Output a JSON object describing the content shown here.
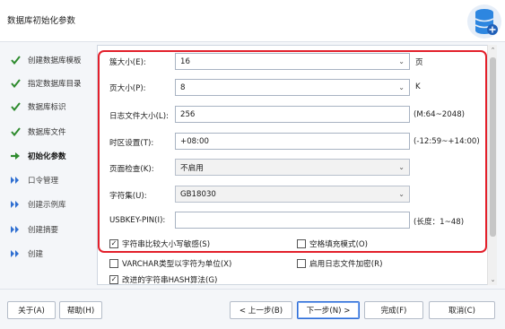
{
  "window": {
    "title": "数据库初始化参数"
  },
  "sidebar": {
    "items": [
      {
        "label": "创建数据库模板",
        "state": "done",
        "icon": "check-icon"
      },
      {
        "label": "指定数据库目录",
        "state": "done",
        "icon": "check-icon"
      },
      {
        "label": "数据库标识",
        "state": "done",
        "icon": "check-icon"
      },
      {
        "label": "数据库文件",
        "state": "done",
        "icon": "check-icon"
      },
      {
        "label": "初始化参数",
        "state": "current",
        "icon": "arrow-right-icon"
      },
      {
        "label": "口令管理",
        "state": "pending",
        "icon": "double-chevron-icon"
      },
      {
        "label": "创建示例库",
        "state": "pending",
        "icon": "double-chevron-icon"
      },
      {
        "label": "创建摘要",
        "state": "pending",
        "icon": "double-chevron-icon"
      },
      {
        "label": "创建",
        "state": "pending",
        "icon": "double-chevron-icon"
      }
    ]
  },
  "form": {
    "extent_size": {
      "label": "簇大小(E):",
      "value": "16",
      "unit": "页"
    },
    "page_size": {
      "label": "页大小(P):",
      "value": "8",
      "unit": "K"
    },
    "log_size": {
      "label": "日志文件大小(L):",
      "value": "256",
      "hint": "(M:64~2048)"
    },
    "time_zone": {
      "label": "时区设置(T):",
      "value": "+08:00",
      "hint": "(-12:59~+14:00)"
    },
    "page_check": {
      "label": "页面检查(K):",
      "value": "不启用"
    },
    "charset": {
      "label": "字符集(U):",
      "value": "GB18030"
    },
    "usbkey_pin": {
      "label": "USBKEY-PIN(I):",
      "value": "",
      "hint": "(长度：1~48)"
    },
    "checkboxes": [
      {
        "label": "字符串比较大小写敏感(S)",
        "checked": true
      },
      {
        "label": "空格填充模式(O)",
        "checked": false
      },
      {
        "label": "VARCHAR类型以字符为单位(X)",
        "checked": false
      },
      {
        "label": "启用日志文件加密(R)",
        "checked": false
      },
      {
        "label": "改进的字符串HASH算法(G)",
        "checked": true
      }
    ]
  },
  "footer": {
    "about": "关于(A)",
    "help": "帮助(H)",
    "prev": "< 上一步(B)",
    "next": "下一步(N) >",
    "finish": "完成(F)",
    "cancel": "取消(C)"
  },
  "colors": {
    "highlight_outline": "#e3202b",
    "check_green": "#2e8b2e",
    "nav_blue": "#2f6fd1"
  }
}
